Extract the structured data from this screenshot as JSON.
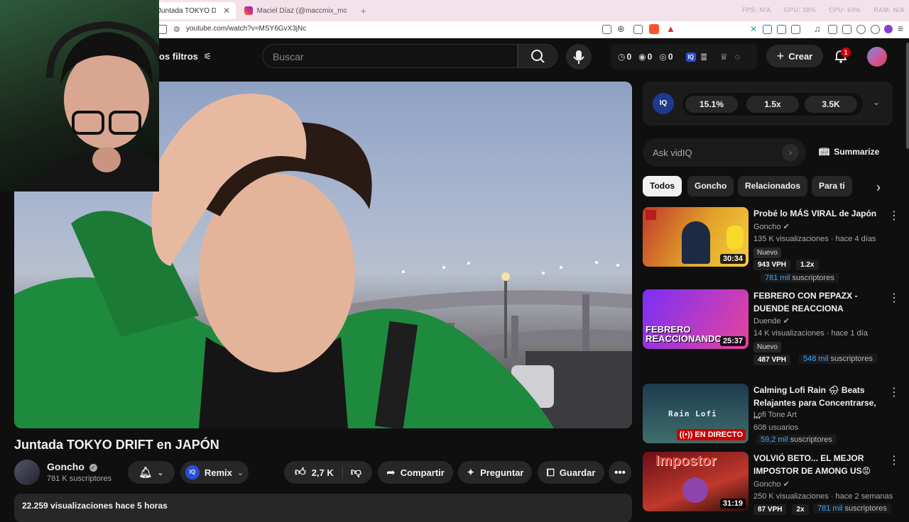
{
  "browser": {
    "tabs": [
      {
        "label": "Juntada TOKYO DRIFT en",
        "active": true
      },
      {
        "label": "Maciel Díaz (@maccmix_motovlog) -",
        "active": false
      }
    ],
    "new_tab": "+",
    "perf": {
      "fps": "FPS: N/A",
      "gpu": "GPU: 38%",
      "cpu": "CPU: 64%",
      "ram": "RAM: N/A"
    },
    "url": "youtube.com/watch?v=MSY6GvX3jNc"
  },
  "header": {
    "filters_label": "os filtros",
    "search_placeholder": "Buscar",
    "stats": [
      "0",
      "0",
      "0"
    ],
    "create_label": "Crear",
    "notification_count": "1"
  },
  "video": {
    "title": "Juntada TOKYO DRIFT en JAPÓN",
    "channel": "Goncho",
    "subscribers": "781 K suscriptores",
    "remix_label": "Remix",
    "likes": "2,7 K",
    "share_label": "Compartir",
    "ask_label": "Preguntar",
    "save_label": "Guardar",
    "views_line": "22.259 visualizaciones  hace 5 horas"
  },
  "vidiq": {
    "logo": "IQ",
    "stats": [
      "15.1%",
      "1.5x",
      "3.5K"
    ],
    "ask_placeholder": "Ask vidIQ",
    "summarize_label": "Summarize"
  },
  "chips": [
    "Todos",
    "Goncho",
    "Relacionados",
    "Para ti"
  ],
  "recommendations": [
    {
      "title": "Probé lo MÁS VIRAL de Japón",
      "channel": "Goncho",
      "meta": "135 K visualizaciones · hace 4 días",
      "badge": "Nuevo",
      "vph": "943 VPH",
      "mult": "1.2x",
      "subs_num": "781 mil",
      "subs_label": "suscriptores",
      "duration": "30:34",
      "thumb_text": "",
      "thumb_colors": [
        "#c0392b",
        "#e3a32a"
      ]
    },
    {
      "title": "FEBRERO CON PEPAZX - DUENDE REACCIONA",
      "channel": "Duende",
      "meta": "14 K visualizaciones · hace 1 día",
      "badge": "Nuevo",
      "vph": "487 VPH",
      "mult": "",
      "subs_num": "548 mil",
      "subs_label": "suscriptores",
      "duration": "25:37",
      "thumb_text": "FEBRERO REACCIONANDO",
      "thumb_colors": [
        "#7b2ff7",
        "#e6449c"
      ]
    },
    {
      "title": "Calming Lofi Rain 🌧 Beats Relajantes para Concentrarse, ...",
      "channel": "Lofi Tone Art",
      "meta": "608 usuarios",
      "badge": "",
      "vph": "",
      "mult": "",
      "subs_num": "59,2 mil",
      "subs_label": "suscriptores",
      "duration": "EN DIRECTO",
      "thumb_text": "Rain Lofi",
      "thumb_colors": [
        "#1d3b4f",
        "#3f6e6b"
      ]
    },
    {
      "title": "VOLVIÓ BETO... EL MEJOR IMPOSTOR DE AMONG US😡",
      "channel": "Goncho",
      "meta": "250 K visualizaciones · hace 2 semanas",
      "badge": "",
      "vph": "87 VPH",
      "mult": "2x",
      "subs_num": "781 mil",
      "subs_label": "suscriptores",
      "duration": "31:19",
      "thumb_text": "Impostor",
      "thumb_colors": [
        "#6b0f1a",
        "#c0392b"
      ]
    }
  ]
}
